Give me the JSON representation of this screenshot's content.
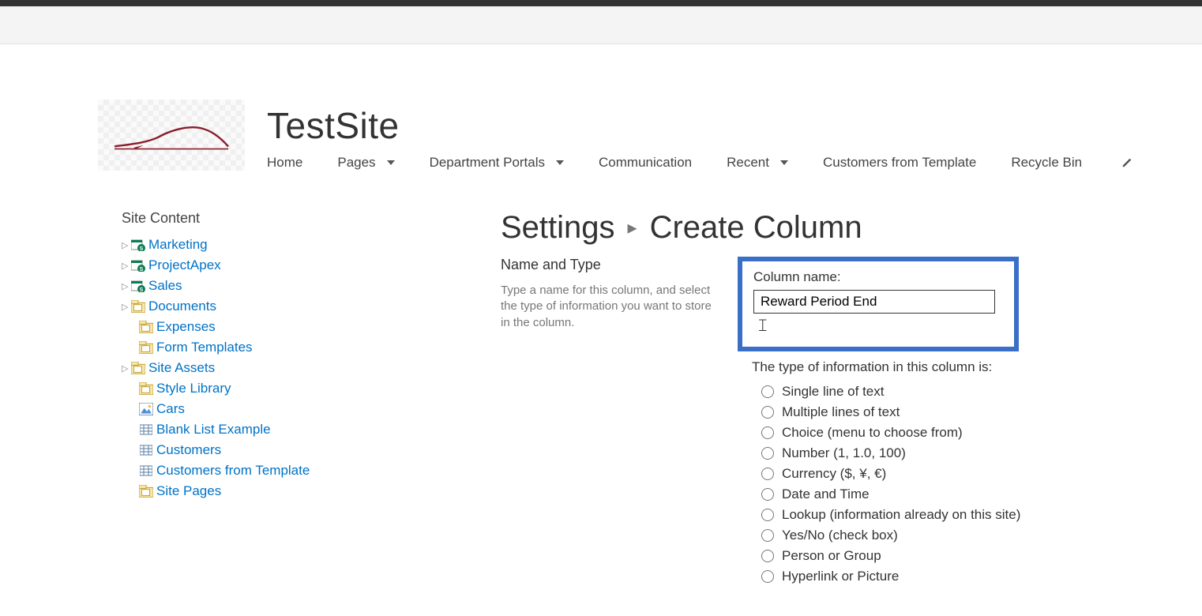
{
  "site": {
    "title": "TestSite"
  },
  "nav": {
    "items": [
      {
        "label": "Home",
        "dropdown": false
      },
      {
        "label": "Pages",
        "dropdown": true
      },
      {
        "label": "Department Portals",
        "dropdown": true
      },
      {
        "label": "Communication",
        "dropdown": false
      },
      {
        "label": "Recent",
        "dropdown": true
      },
      {
        "label": "Customers from Template",
        "dropdown": false
      },
      {
        "label": "Recycle Bin",
        "dropdown": false
      }
    ]
  },
  "leftnav": {
    "title": "Site Content",
    "items": [
      {
        "label": "Marketing",
        "type": "subsite",
        "expandable": true
      },
      {
        "label": "ProjectApex",
        "type": "subsite",
        "expandable": true
      },
      {
        "label": "Sales",
        "type": "subsite",
        "expandable": true
      },
      {
        "label": "Documents",
        "type": "library",
        "expandable": true
      },
      {
        "label": "Expenses",
        "type": "library",
        "expandable": false
      },
      {
        "label": "Form Templates",
        "type": "library",
        "expandable": false
      },
      {
        "label": "Site Assets",
        "type": "library",
        "expandable": true
      },
      {
        "label": "Style Library",
        "type": "library",
        "expandable": false
      },
      {
        "label": "Cars",
        "type": "piclib",
        "expandable": false
      },
      {
        "label": "Blank List Example",
        "type": "list",
        "expandable": false
      },
      {
        "label": "Customers",
        "type": "list",
        "expandable": false
      },
      {
        "label": "Customers from Template",
        "type": "list",
        "expandable": false
      },
      {
        "label": "Site Pages",
        "type": "library",
        "expandable": false
      }
    ]
  },
  "page": {
    "breadcrumb_root": "Settings",
    "breadcrumb_sep": "▸",
    "title": "Create Column",
    "section_title": "Name and Type",
    "section_desc": "Type a name for this column, and select the type of information you want to store in the column.",
    "colname_label": "Column name:",
    "colname_value": "Reward Period End",
    "type_label": "The type of information in this column is:",
    "types": [
      "Single line of text",
      "Multiple lines of text",
      "Choice (menu to choose from)",
      "Number (1, 1.0, 100)",
      "Currency ($, ¥, €)",
      "Date and Time",
      "Lookup (information already on this site)",
      "Yes/No (check box)",
      "Person or Group",
      "Hyperlink or Picture"
    ]
  }
}
